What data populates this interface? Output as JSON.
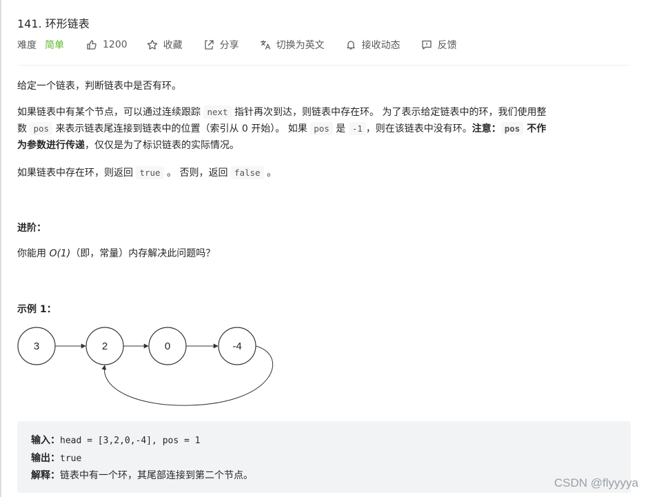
{
  "problem": {
    "title": "141. 环形链表",
    "difficulty_label": "难度",
    "difficulty": "简单",
    "likes": "1200",
    "favorite": "收藏",
    "share": "分享",
    "translate": "切换为英文",
    "notify": "接收动态",
    "feedback": "反馈"
  },
  "description": {
    "p1": "给定一个链表，判断链表中是否有环。",
    "p2": {
      "t1": "如果链表中有某个节点，可以通过连续跟踪 ",
      "c1": "next",
      "t2": " 指针再次到达，则链表中存在环。 为了表示给定链表中的环，我们使用整",
      "t3": "数 ",
      "c2": "pos",
      "t4": " 来表示链表尾连接到链表中的位置（索引从 0 开始）。 如果 ",
      "c3": "pos",
      "t5": " 是 ",
      "c4": "-1",
      "t6": "，则在该链表中没有环。",
      "b1": "注意：",
      "c5": "pos",
      "b2": " 不作",
      "b3": "为参数进行传递",
      "t7": "，仅仅是为了标识链表的实际情况。"
    },
    "p3": {
      "t1": "如果链表中存在环，则返回 ",
      "c1": "true",
      "t2": " 。 否则，返回 ",
      "c2": "false",
      "t3": " 。"
    },
    "advanced_title": "进阶：",
    "advanced": {
      "t1": "你能用 ",
      "em": "O(1)",
      "t2": "（即，常量）内存解决此问题吗？"
    }
  },
  "example": {
    "title": "示例 1：",
    "nodes": [
      "3",
      "2",
      "0",
      "-4"
    ],
    "input_label": "输入：",
    "input": "head = [3,2,0,-4], pos = 1",
    "output_label": "输出：",
    "output": "true",
    "explain_label": "解释：",
    "explain": "链表中有一个环，其尾部连接到第二个节点。"
  },
  "watermark": "CSDN @flyyyya",
  "colors": {
    "easy": "#5ab726",
    "example_bg": "#f2f3f4"
  }
}
